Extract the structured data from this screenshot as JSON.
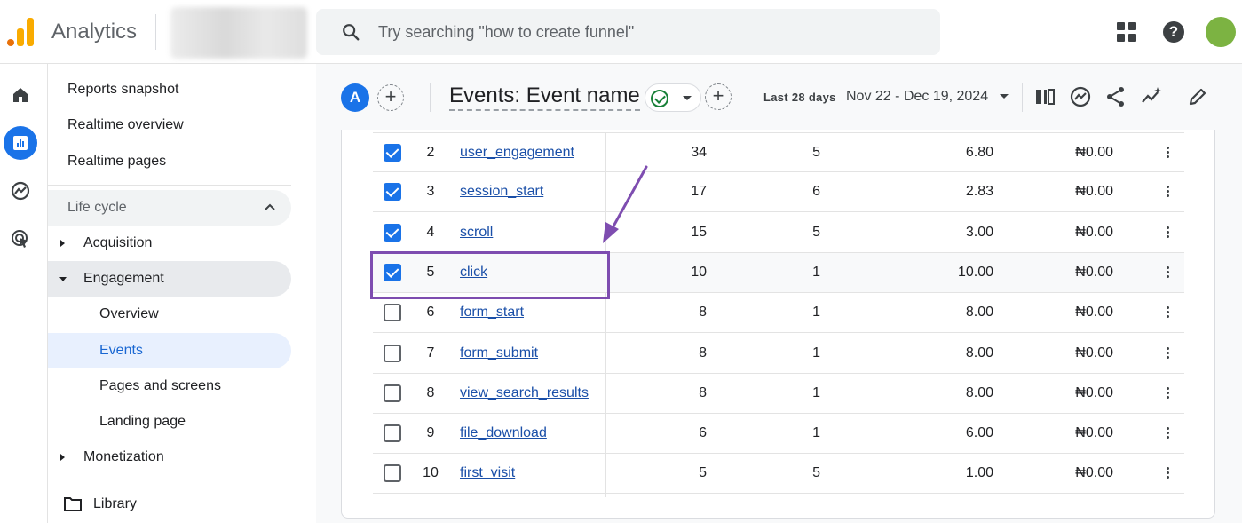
{
  "app": {
    "title": "Analytics"
  },
  "search": {
    "placeholder": "Try searching \"how to create funnel\""
  },
  "rail": {
    "icons": [
      "home-icon",
      "reports-icon",
      "explore-icon",
      "advertising-icon"
    ]
  },
  "nav": {
    "reports_snapshot": "Reports snapshot",
    "realtime_overview": "Realtime overview",
    "realtime_pages": "Realtime pages",
    "lifecycle": "Life cycle",
    "acquisition": "Acquisition",
    "engagement": "Engagement",
    "overview": "Overview",
    "events": "Events",
    "pages_and_screens": "Pages and screens",
    "landing_page": "Landing page",
    "monetization": "Monetization",
    "library": "Library"
  },
  "header": {
    "comparison_chip": "A",
    "report_title": "Events: Event name",
    "date_label": "Last 28 days",
    "date_range": "Nov 22 - Dec 19, 2024"
  },
  "table": {
    "rows": [
      {
        "index": "2",
        "name": "user_engagement",
        "count": "34",
        "users": "5",
        "per_user": "6.80",
        "revenue": "₦0.00",
        "checked": true
      },
      {
        "index": "3",
        "name": "session_start",
        "count": "17",
        "users": "6",
        "per_user": "2.83",
        "revenue": "₦0.00",
        "checked": true
      },
      {
        "index": "4",
        "name": "scroll",
        "count": "15",
        "users": "5",
        "per_user": "3.00",
        "revenue": "₦0.00",
        "checked": true
      },
      {
        "index": "5",
        "name": "click",
        "count": "10",
        "users": "1",
        "per_user": "10.00",
        "revenue": "₦0.00",
        "checked": true
      },
      {
        "index": "6",
        "name": "form_start",
        "count": "8",
        "users": "1",
        "per_user": "8.00",
        "revenue": "₦0.00",
        "checked": false
      },
      {
        "index": "7",
        "name": "form_submit",
        "count": "8",
        "users": "1",
        "per_user": "8.00",
        "revenue": "₦0.00",
        "checked": false
      },
      {
        "index": "8",
        "name": "view_search_results",
        "count": "8",
        "users": "1",
        "per_user": "8.00",
        "revenue": "₦0.00",
        "checked": false
      },
      {
        "index": "9",
        "name": "file_download",
        "count": "6",
        "users": "1",
        "per_user": "6.00",
        "revenue": "₦0.00",
        "checked": false
      },
      {
        "index": "10",
        "name": "first_visit",
        "count": "5",
        "users": "5",
        "per_user": "1.00",
        "revenue": "₦0.00",
        "checked": false
      }
    ]
  },
  "colors": {
    "accent": "#1a73e8",
    "highlight": "#7e4db0",
    "link": "#1a4fa8"
  }
}
